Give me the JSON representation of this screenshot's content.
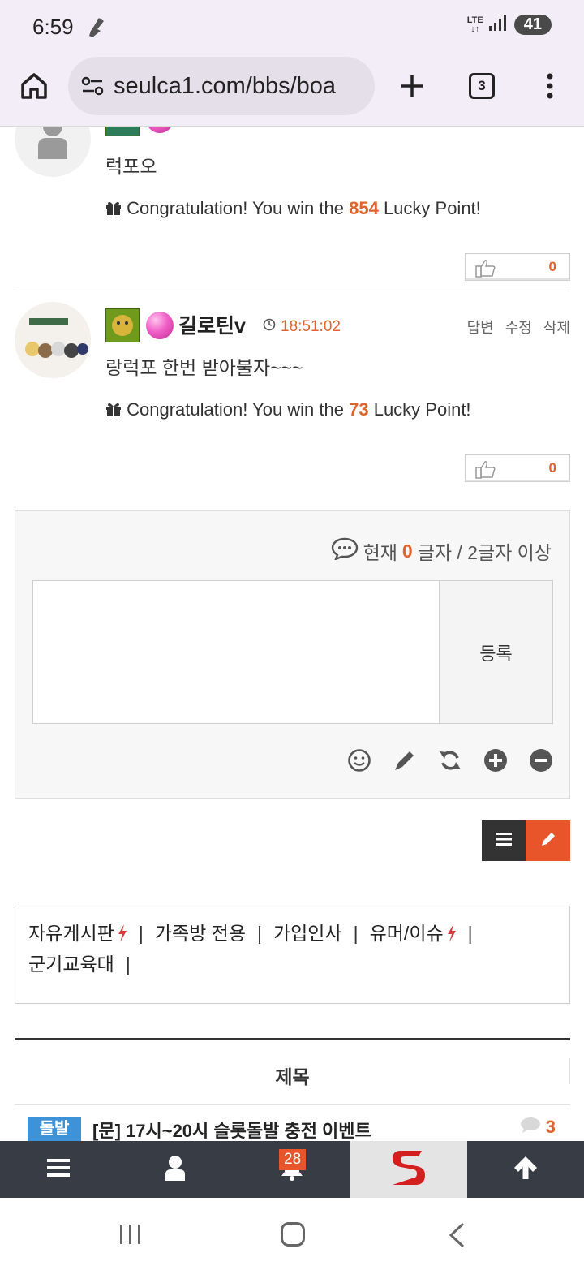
{
  "status_bar": {
    "time": "6:59",
    "network": "LTE",
    "battery": "41"
  },
  "browser": {
    "url": "seulca1.com/bbs/boa",
    "tab_count": "3"
  },
  "comments": [
    {
      "text": "럭포오",
      "lucky_prefix": "Congratulation! You win the ",
      "lucky_points": "854",
      "lucky_suffix": " Lucky Point!",
      "likes": "0"
    },
    {
      "nickname": "길로틴v",
      "time": "18:51:02",
      "actions": [
        "답변",
        "수정",
        "삭제"
      ],
      "text": "랑럭포 한번 받아불자~~~",
      "lucky_prefix": "Congratulation! You win the ",
      "lucky_points": "73",
      "lucky_suffix": " Lucky Point!",
      "likes": "0"
    }
  ],
  "comment_form": {
    "count_prefix": "현재 ",
    "count_value": "0",
    "count_suffix": "글자 / 2글자 이상",
    "submit_label": "등록"
  },
  "categories": [
    {
      "label": "자유게시판",
      "hot": true
    },
    {
      "label": "가족방 전용",
      "hot": false
    },
    {
      "label": "가입인사",
      "hot": false
    },
    {
      "label": "유머/이슈",
      "hot": true
    },
    {
      "label": "군기교육대",
      "hot": false
    }
  ],
  "table": {
    "header": "제목"
  },
  "post": {
    "tag": "돌발",
    "title": "[문] 17시~20시 슬롯돌발 충전 이벤트",
    "comment_count": "3"
  },
  "bottom_nav": {
    "notification_count": "28"
  },
  "colors": {
    "accent": "#e0622c",
    "dark_nav": "#373c45",
    "tag_blue": "#3e92d8"
  }
}
